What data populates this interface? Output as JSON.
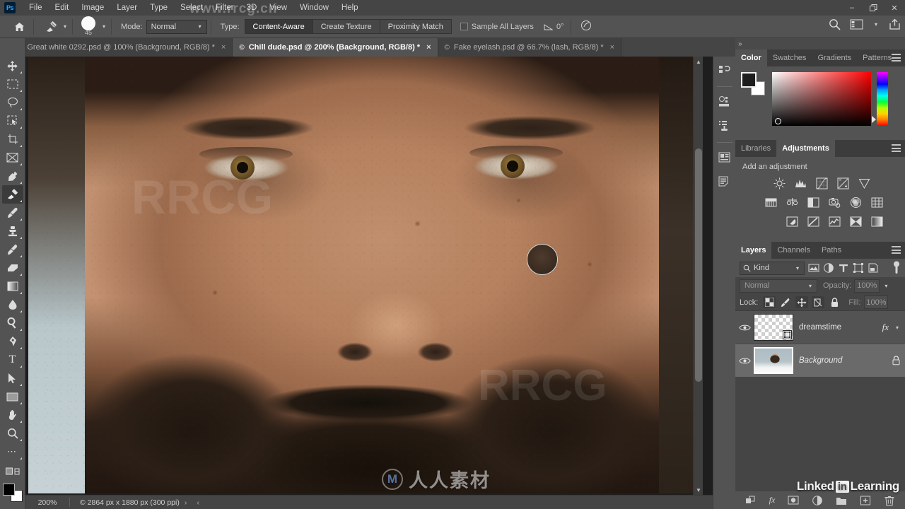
{
  "app": {
    "logo": "Ps",
    "menus": [
      "File",
      "Edit",
      "Image",
      "Layer",
      "Type",
      "Select",
      "Filter",
      "3D",
      "View",
      "Window",
      "Help"
    ],
    "window_controls": {
      "minimize": "–",
      "restore": "❐",
      "close": "✕"
    },
    "watermark_url": "www.rrcg.cn"
  },
  "options_bar": {
    "home_icon": "home-icon",
    "tool_icon": "spot-healing-brush-icon",
    "brush_size": "45",
    "mode_label": "Mode:",
    "mode_value": "Normal",
    "type_label": "Type:",
    "type_options": [
      "Content-Aware",
      "Create Texture",
      "Proximity Match"
    ],
    "type_selected": "Content-Aware",
    "sample_all_layers_label": "Sample All Layers",
    "sample_all_layers_checked": false,
    "angle_value": "0°",
    "pressure_icon": "pressure-size-icon"
  },
  "tabs": [
    {
      "title": "Great white 0292.psd @ 100% (Background, RGB/8) *",
      "active": false
    },
    {
      "title": "Chill dude.psd @ 200% (Background, RGB/8) *",
      "active": true
    },
    {
      "title": "Fake eyelash.psd @ 66.7% (lash, RGB/8) *",
      "active": false
    }
  ],
  "toolbar": {
    "tools": [
      {
        "name": "move-tool",
        "glyph": "✥",
        "selected": false
      },
      {
        "name": "rectangular-marquee-tool",
        "glyph": "⬚",
        "selected": false
      },
      {
        "name": "lasso-tool",
        "glyph": "℘",
        "selected": false
      },
      {
        "name": "object-selection-tool",
        "glyph": "⧉",
        "selected": false
      },
      {
        "name": "crop-tool",
        "glyph": "⌗",
        "selected": false
      },
      {
        "name": "frame-tool",
        "glyph": "☒",
        "selected": false
      },
      {
        "name": "eyedropper-tool",
        "glyph": "✒",
        "selected": false
      },
      {
        "name": "spot-healing-brush-tool",
        "glyph": "✐",
        "selected": true
      },
      {
        "name": "brush-tool",
        "glyph": "✎",
        "selected": false
      },
      {
        "name": "clone-stamp-tool",
        "glyph": "♟",
        "selected": false
      },
      {
        "name": "history-brush-tool",
        "glyph": "✐",
        "selected": false
      },
      {
        "name": "eraser-tool",
        "glyph": "▰",
        "selected": false
      },
      {
        "name": "gradient-tool",
        "glyph": "▣",
        "selected": false
      },
      {
        "name": "blur-tool",
        "glyph": "●",
        "selected": false
      },
      {
        "name": "dodge-tool",
        "glyph": "⚲",
        "selected": false
      },
      {
        "name": "pen-tool",
        "glyph": "✐",
        "selected": false
      },
      {
        "name": "type-tool",
        "glyph": "T",
        "selected": false
      },
      {
        "name": "path-selection-tool",
        "glyph": "➤",
        "selected": false
      },
      {
        "name": "rectangle-tool",
        "glyph": "▭",
        "selected": false
      },
      {
        "name": "hand-tool",
        "glyph": "✋",
        "selected": false
      },
      {
        "name": "zoom-tool",
        "glyph": "⚲",
        "selected": false
      },
      {
        "name": "edit-toolbar-button",
        "glyph": "⋯",
        "selected": false
      }
    ],
    "quickmask_icon": "quick-mask-icon",
    "screenmode_icon": "screen-mode-icon",
    "foreground_color": "#000000",
    "background_color": "#ffffff"
  },
  "canvas": {
    "image_description": "close-up portrait of a bearded man",
    "brush_cursor": "healing-brush-cursor",
    "watermark_text": "人人素材",
    "watermark_mark": "M"
  },
  "status_bar": {
    "zoom": "200%",
    "doc_info": "© 2864 px x 1880 px (300 ppi)",
    "next_arrow": "›",
    "prev_arrow": "‹"
  },
  "dock_rail": {
    "icons": [
      "history-icon",
      "properties-icon",
      "actions-icon",
      "character-icon",
      "paragraph-icon"
    ]
  },
  "color_panel": {
    "tabs": [
      "Color",
      "Swatches",
      "Gradients",
      "Patterns"
    ],
    "active_tab": "Color",
    "foreground": "#1d1d1d",
    "background": "#ffffff",
    "spectrum": "red-ramp"
  },
  "adjustments_panel": {
    "tabs": [
      "Libraries",
      "Adjustments"
    ],
    "active_tab": "Adjustments",
    "title": "Add an adjustment",
    "row1": [
      "brightness-contrast-icon",
      "levels-icon",
      "curves-icon",
      "exposure-icon",
      "vibrance-icon"
    ],
    "row2": [
      "hue-saturation-icon",
      "color-balance-icon",
      "black-white-icon",
      "photo-filter-icon",
      "channel-mixer-icon",
      "color-lookup-icon"
    ],
    "row3": [
      "invert-icon",
      "posterize-icon",
      "threshold-icon",
      "selective-color-icon",
      "gradient-map-icon"
    ]
  },
  "layers_panel": {
    "tabs": [
      "Layers",
      "Channels",
      "Paths"
    ],
    "active_tab": "Layers",
    "filter_kind": "Kind",
    "filter_icons": [
      "filter-pixel-icon",
      "filter-adjustment-icon",
      "filter-type-icon",
      "filter-shape-icon",
      "filter-smart-object-icon"
    ],
    "filter_toggle": "filter-toggle-switch",
    "blend_mode": "Normal",
    "opacity_label": "Opacity:",
    "opacity_value": "100%",
    "lock_label": "Lock:",
    "lock_icons": [
      "lock-transparent-pixels-icon",
      "lock-image-pixels-icon",
      "lock-position-icon",
      "lock-artboard-nesting-icon",
      "lock-all-icon"
    ],
    "fill_label": "Fill:",
    "fill_value": "100%",
    "layers": [
      {
        "name": "dreamstime",
        "visible": true,
        "selected": false,
        "has_fx": true,
        "fx_label": "fx",
        "thumb": "transparent",
        "italic": false
      },
      {
        "name": "Background",
        "visible": true,
        "selected": true,
        "has_fx": false,
        "locked": true,
        "thumb": "portrait",
        "italic": true
      }
    ],
    "footer_icons": [
      "link-layers-icon",
      "layer-style-icon",
      "add-mask-icon",
      "new-adjustment-layer-icon",
      "new-group-icon",
      "new-layer-icon",
      "delete-layer-icon"
    ]
  },
  "branding": {
    "linkedin": "Linked",
    "in": "in",
    "learning": "Learning"
  }
}
